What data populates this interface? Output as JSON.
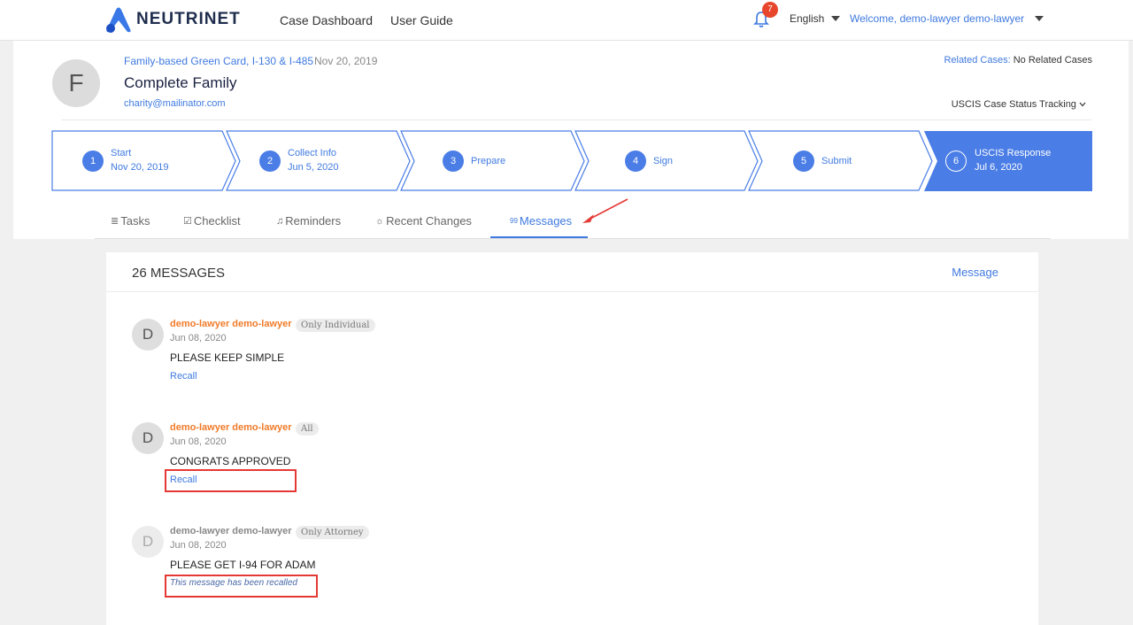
{
  "nav": {
    "brand": "NEUTRINET",
    "links": [
      "Case Dashboard",
      "User Guide"
    ],
    "notification_count": "7",
    "language": "English",
    "welcome": "Welcome, demo-lawyer demo-lawyer"
  },
  "case": {
    "avatar_initial": "F",
    "type": "Family-based Green Card, I-130 & I-485",
    "date": "Nov 20, 2019",
    "name": "Complete Family",
    "email": "charity@mailinator.com",
    "related_label": "Related Cases:",
    "related_value": "No Related Cases",
    "tracking": "USCIS Case Status Tracking"
  },
  "steps": [
    {
      "num": "1",
      "title": "Start",
      "date": "Nov 20, 2019"
    },
    {
      "num": "2",
      "title": "Collect Info",
      "date": "Jun 5, 2020"
    },
    {
      "num": "3",
      "title": "Prepare",
      "date": ""
    },
    {
      "num": "4",
      "title": "Sign",
      "date": ""
    },
    {
      "num": "5",
      "title": "Submit",
      "date": ""
    },
    {
      "num": "6",
      "title": "USCIS Response",
      "date": "Jul 6, 2020"
    }
  ],
  "tabs": [
    {
      "icon": "≣",
      "label": "Tasks"
    },
    {
      "icon": "☑",
      "label": "Checklist"
    },
    {
      "icon": "♫",
      "label": "Reminders"
    },
    {
      "icon": "☼",
      "label": "Recent Changes"
    },
    {
      "icon": "99",
      "label": "Messages"
    }
  ],
  "messages_panel": {
    "count_label": "26 MESSAGES",
    "new_message": "Message",
    "items": [
      {
        "initial": "D",
        "author": "demo-lawyer demo-lawyer",
        "tag": "Only Individual",
        "date": "Jun 08, 2020",
        "text": "PLEASE KEEP SIMPLE",
        "action": "Recall"
      },
      {
        "initial": "D",
        "author": "demo-lawyer demo-lawyer",
        "tag": "All",
        "date": "Jun 08, 2020",
        "text": "CONGRATS APPROVED",
        "action": "Recall"
      },
      {
        "initial": "D",
        "author": "demo-lawyer demo-lawyer",
        "tag": "Only Attorney",
        "date": "Jun 08, 2020",
        "text": "PLEASE GET I-94 FOR ADAM",
        "recalled_note": "This message has been recalled"
      }
    ]
  },
  "colors": {
    "accent": "#3f7ae0",
    "active_step": "#4a7de6",
    "author": "#f07b2a",
    "highlight": "#e53935",
    "badge": "#e8462c"
  }
}
